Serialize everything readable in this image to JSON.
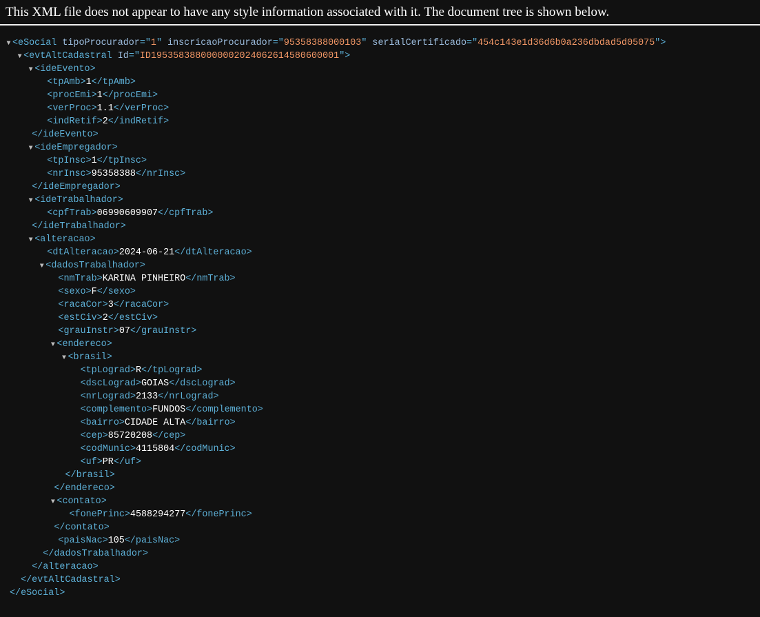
{
  "header": {
    "notice": "This XML file does not appear to have any style information associated with it. The document tree is shown below."
  },
  "icons": {
    "expanded_toggle": "triangle-down"
  },
  "colors": {
    "tag": "#5db0d7",
    "attribute_name": "#9bbbdc",
    "attribute_value": "#f29766",
    "text": "#ffffff",
    "background": "#111111"
  },
  "tree": {
    "esocial": {
      "tag": "eSocial",
      "attrs": [
        {
          "name": "tipoProcurador",
          "value": "1"
        },
        {
          "name": "inscricaoProcurador",
          "value": "95358388000103"
        },
        {
          "name": "serialCertificado",
          "value": "454c143e1d36d6b0a236dbdad5d05075"
        }
      ]
    },
    "evt": {
      "tag": "evtAltCadastral",
      "attrs": [
        {
          "name": "Id",
          "value": "ID1953583880000002024062614580600001"
        }
      ]
    },
    "ideEvento": {
      "tag": "ideEvento",
      "children": [
        {
          "tag": "tpAmb",
          "text": "1"
        },
        {
          "tag": "procEmi",
          "text": "1"
        },
        {
          "tag": "verProc",
          "text": "1.1"
        },
        {
          "tag": "indRetif",
          "text": "2"
        }
      ]
    },
    "ideEmpregador": {
      "tag": "ideEmpregador",
      "children": [
        {
          "tag": "tpInsc",
          "text": "1"
        },
        {
          "tag": "nrInsc",
          "text": "95358388"
        }
      ]
    },
    "ideTrabalhador": {
      "tag": "ideTrabalhador",
      "children": [
        {
          "tag": "cpfTrab",
          "text": "06990609907"
        }
      ]
    },
    "alteracao": {
      "tag": "alteracao",
      "dtAlteracao": {
        "tag": "dtAlteracao",
        "text": "2024-06-21"
      }
    },
    "dadosTrabalhador": {
      "tag": "dadosTrabalhador",
      "children": [
        {
          "tag": "nmTrab",
          "text": "KARINA PINHEIRO"
        },
        {
          "tag": "sexo",
          "text": "F"
        },
        {
          "tag": "racaCor",
          "text": "3"
        },
        {
          "tag": "estCiv",
          "text": "2"
        },
        {
          "tag": "grauInstr",
          "text": "07"
        }
      ],
      "paisNac": {
        "tag": "paisNac",
        "text": "105"
      }
    },
    "endereco": {
      "tag": "endereco"
    },
    "brasil": {
      "tag": "brasil",
      "children": [
        {
          "tag": "tpLograd",
          "text": "R"
        },
        {
          "tag": "dscLograd",
          "text": "GOIAS"
        },
        {
          "tag": "nrLograd",
          "text": "2133"
        },
        {
          "tag": "complemento",
          "text": "FUNDOS"
        },
        {
          "tag": "bairro",
          "text": "CIDADE ALTA"
        },
        {
          "tag": "cep",
          "text": "85720208"
        },
        {
          "tag": "codMunic",
          "text": "4115804"
        },
        {
          "tag": "uf",
          "text": "PR"
        }
      ]
    },
    "contato": {
      "tag": "contato",
      "children": [
        {
          "tag": "fonePrinc",
          "text": "4588294277"
        }
      ]
    }
  }
}
